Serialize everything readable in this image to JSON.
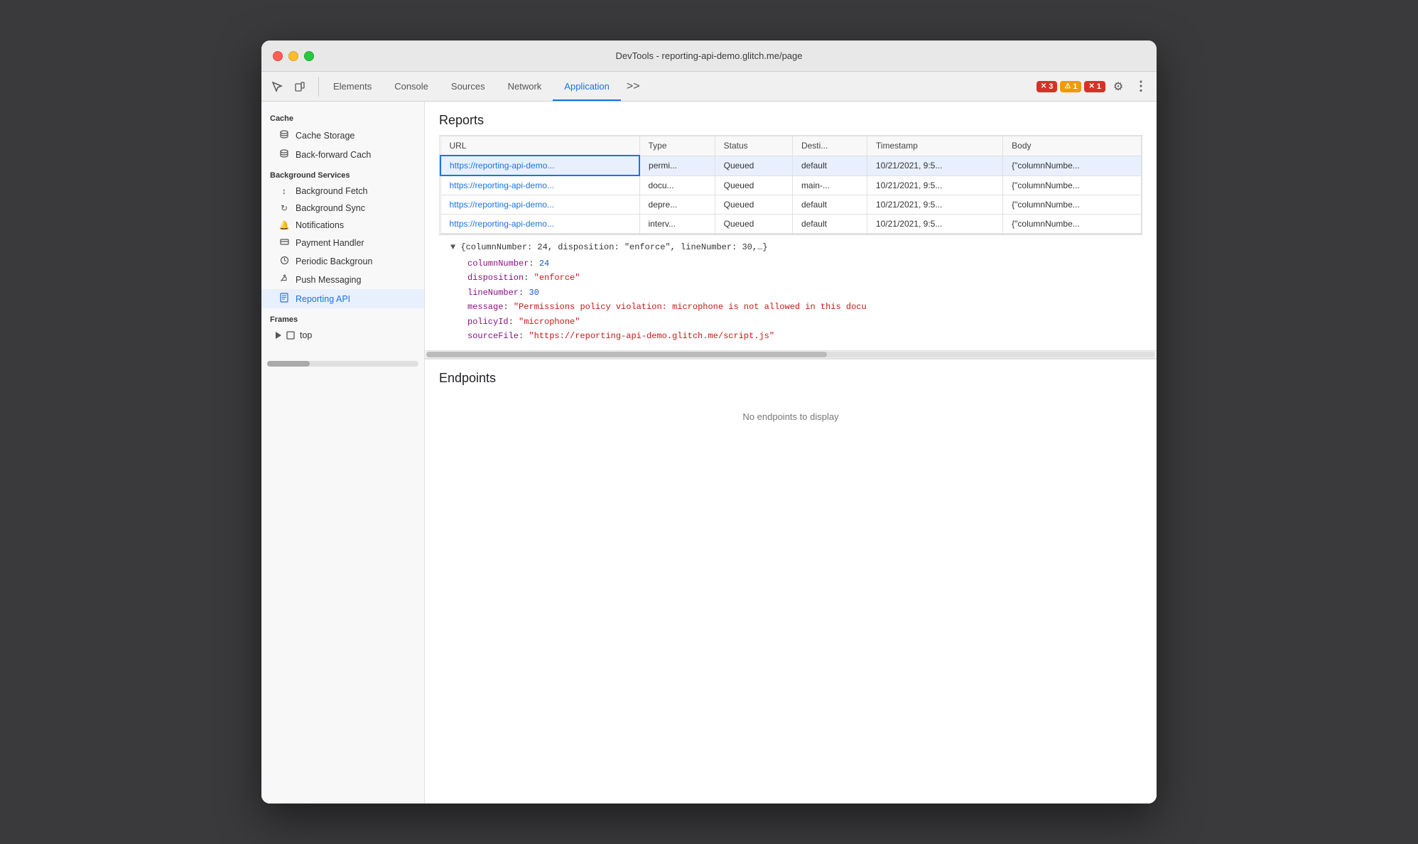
{
  "titlebar": {
    "title": "DevTools - reporting-api-demo.glitch.me/page"
  },
  "toolbar": {
    "tabs": [
      {
        "id": "elements",
        "label": "Elements",
        "active": false
      },
      {
        "id": "console",
        "label": "Console",
        "active": false
      },
      {
        "id": "sources",
        "label": "Sources",
        "active": false
      },
      {
        "id": "network",
        "label": "Network",
        "active": false
      },
      {
        "id": "application",
        "label": "Application",
        "active": true
      }
    ],
    "more_tabs_label": ">>",
    "error_count": "3",
    "warn_count": "1",
    "err2_count": "1",
    "gear_icon": "⚙",
    "more_icon": "⋮"
  },
  "sidebar": {
    "cache_label": "Cache",
    "cache_storage_label": "Cache Storage",
    "back_forward_label": "Back-forward Cach",
    "background_services_label": "Background Services",
    "bg_fetch_label": "Background Fetch",
    "bg_sync_label": "Background Sync",
    "notifications_label": "Notifications",
    "payment_handler_label": "Payment Handler",
    "periodic_bg_label": "Periodic Backgroun",
    "push_messaging_label": "Push Messaging",
    "reporting_api_label": "Reporting API",
    "frames_label": "Frames",
    "top_label": "top"
  },
  "reports": {
    "title": "Reports",
    "columns": {
      "url": "URL",
      "type": "Type",
      "status": "Status",
      "destination": "Desti...",
      "timestamp": "Timestamp",
      "body": "Body"
    },
    "rows": [
      {
        "url": "https://reporting-api-demo...",
        "type": "permi...",
        "status": "Queued",
        "destination": "default",
        "timestamp": "10/21/2021, 9:5...",
        "body": "{\"columnNumbe...",
        "selected": true
      },
      {
        "url": "https://reporting-api-demo...",
        "type": "docu...",
        "status": "Queued",
        "destination": "main-...",
        "timestamp": "10/21/2021, 9:5...",
        "body": "{\"columnNumbe...",
        "selected": false
      },
      {
        "url": "https://reporting-api-demo...",
        "type": "depre...",
        "status": "Queued",
        "destination": "default",
        "timestamp": "10/21/2021, 9:5...",
        "body": "{\"columnNumbe...",
        "selected": false
      },
      {
        "url": "https://reporting-api-demo...",
        "type": "interv...",
        "status": "Queued",
        "destination": "default",
        "timestamp": "10/21/2021, 9:5...",
        "body": "{\"columnNumbe...",
        "selected": false
      }
    ],
    "detail": {
      "header": "▼ {columnNumber: 24, disposition: \"enforce\", lineNumber: 30,…}",
      "lines": [
        {
          "key": "columnNumber",
          "value": "24",
          "type": "number"
        },
        {
          "key": "disposition",
          "value": "\"enforce\"",
          "type": "string"
        },
        {
          "key": "lineNumber",
          "value": "30",
          "type": "number"
        },
        {
          "key": "message",
          "value": "\"Permissions policy violation: microphone is not allowed in this docu",
          "type": "string"
        },
        {
          "key": "policyId",
          "value": "\"microphone\"",
          "type": "string"
        },
        {
          "key": "sourceFile",
          "value": "\"https://reporting-api-demo.glitch.me/script.js\"",
          "type": "string"
        }
      ]
    }
  },
  "endpoints": {
    "title": "Endpoints",
    "no_data": "No endpoints to display"
  }
}
